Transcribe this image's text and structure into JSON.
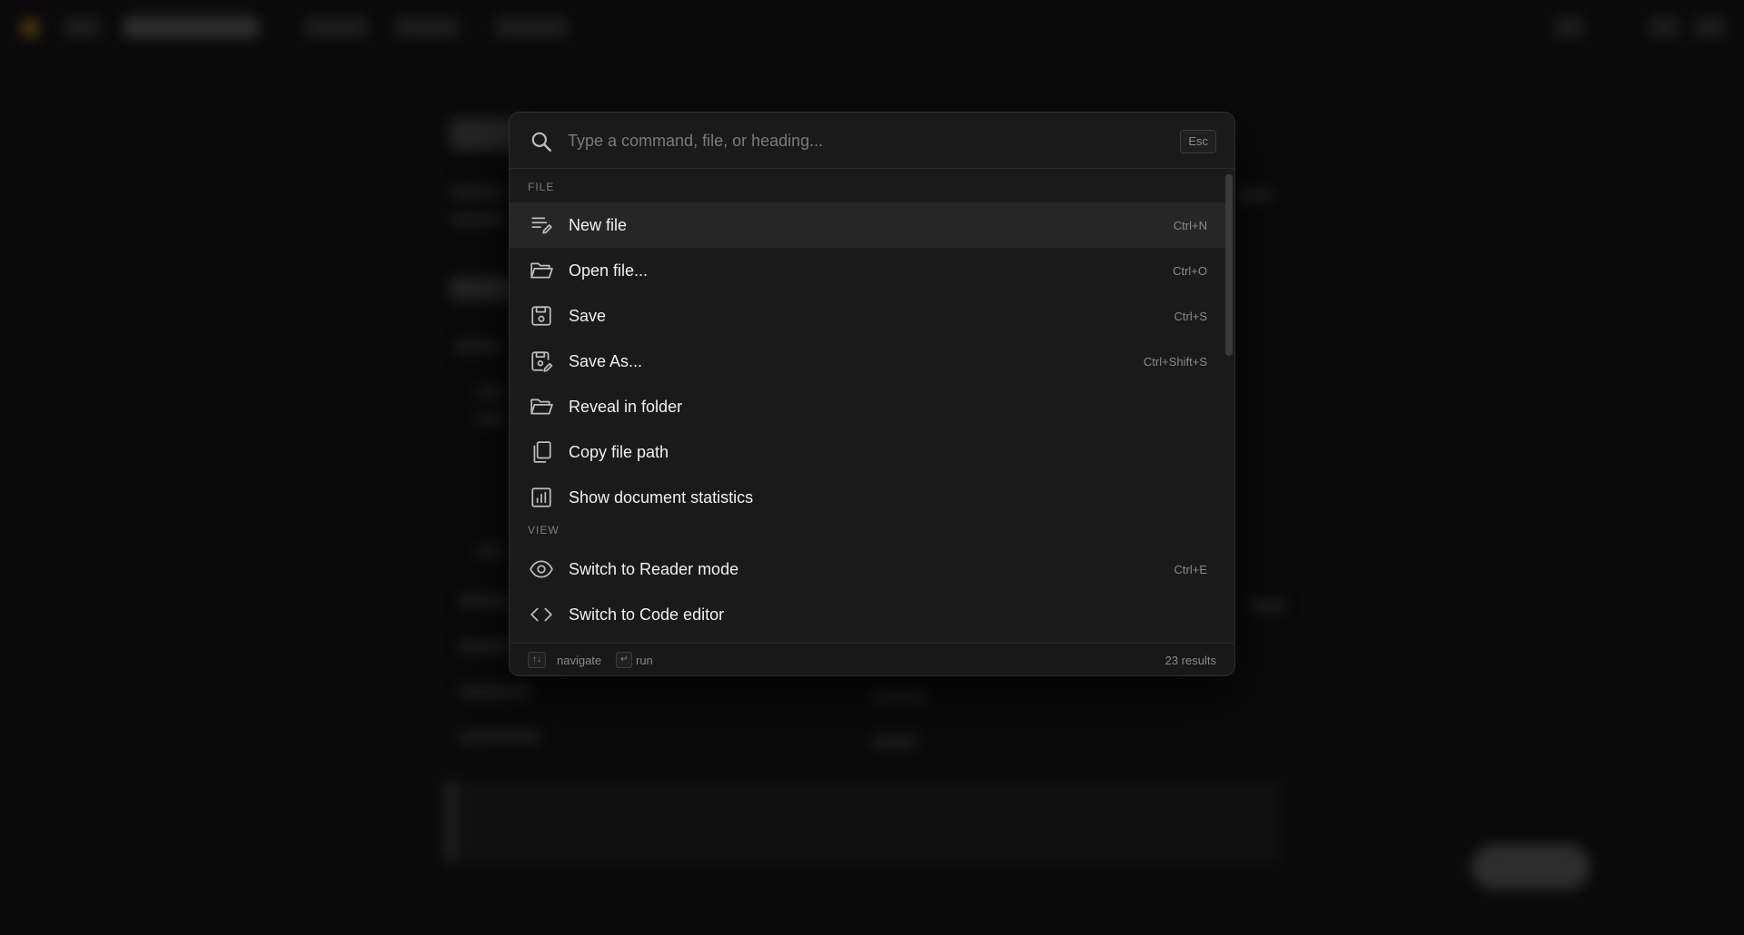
{
  "search": {
    "placeholder": "Type a command, file, or heading...",
    "esc_label": "Esc"
  },
  "sections": {
    "file": "FILE",
    "view": "VIEW"
  },
  "items": [
    {
      "label": "New file",
      "shortcut": "Ctrl+N",
      "icon": "new-file-icon"
    },
    {
      "label": "Open file...",
      "shortcut": "Ctrl+O",
      "icon": "folder-open-icon"
    },
    {
      "label": "Save",
      "shortcut": "Ctrl+S",
      "icon": "save-icon"
    },
    {
      "label": "Save As...",
      "shortcut": "Ctrl+Shift+S",
      "icon": "save-as-icon"
    },
    {
      "label": "Reveal in folder",
      "shortcut": "",
      "icon": "folder-icon"
    },
    {
      "label": "Copy file path",
      "shortcut": "",
      "icon": "copy-icon"
    },
    {
      "label": "Show document statistics",
      "shortcut": "",
      "icon": "statistics-icon"
    },
    {
      "label": "Switch to Reader mode",
      "shortcut": "Ctrl+E",
      "icon": "eye-icon"
    },
    {
      "label": "Switch to Code editor",
      "shortcut": "",
      "icon": "code-icon"
    }
  ],
  "footer": {
    "navigate_key": "↑↓",
    "navigate_label": "navigate",
    "run_key": "↵",
    "run_label": "run",
    "result_count": "23 results"
  },
  "colors": {
    "palette_bg": "#1a1a1a",
    "active_row": "#262626",
    "backdrop": "#0a0a0a"
  }
}
